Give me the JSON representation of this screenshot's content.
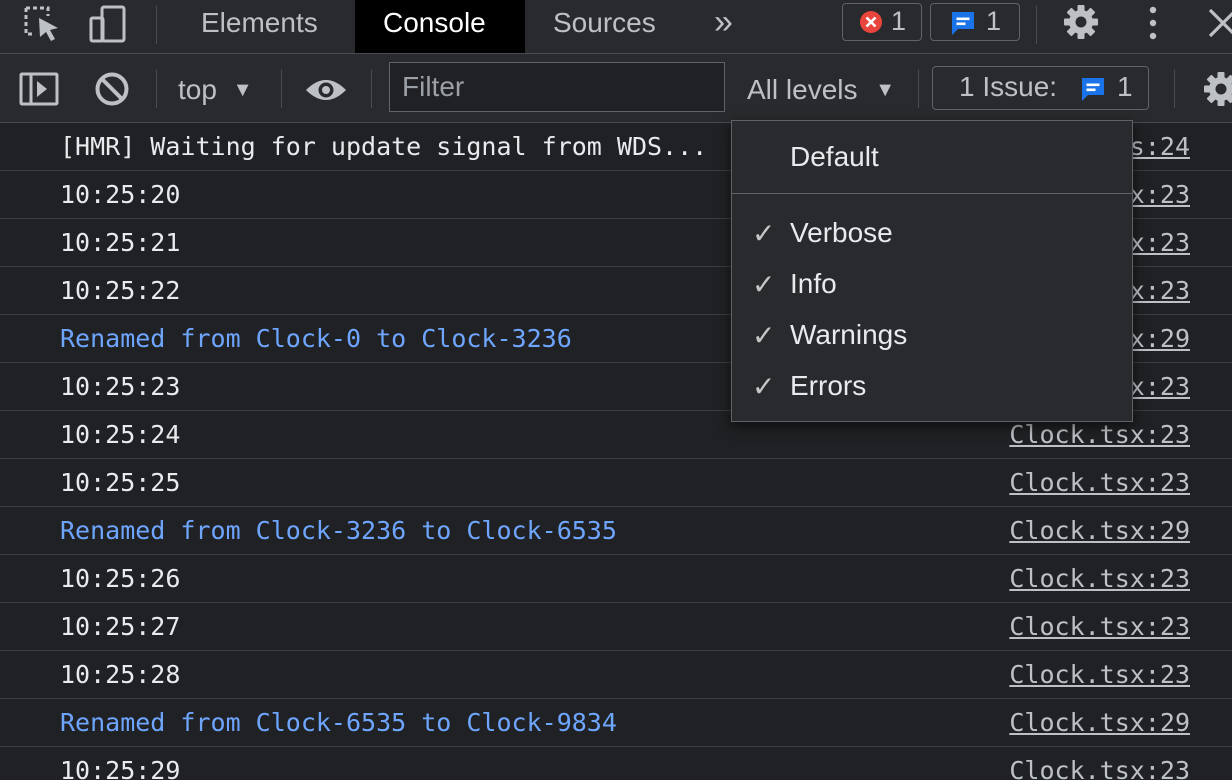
{
  "tabs": {
    "items": [
      {
        "label": "Elements"
      },
      {
        "label": "Console"
      },
      {
        "label": "Sources"
      }
    ],
    "more": "»",
    "errors_count": "1",
    "messages_count": "1"
  },
  "toolbar": {
    "context": "top",
    "filter_placeholder": "Filter",
    "levels_label": "All levels",
    "issues_label": "1 Issue:",
    "issues_count": "1"
  },
  "levels_menu": {
    "default_label": "Default",
    "items": [
      {
        "label": "Verbose",
        "checked": true
      },
      {
        "label": "Info",
        "checked": true
      },
      {
        "label": "Warnings",
        "checked": true
      },
      {
        "label": "Errors",
        "checked": true
      }
    ]
  },
  "console": {
    "rows": [
      {
        "message": "[HMR] Waiting for update signal from WDS...",
        "source": "log.js:24",
        "type": "log"
      },
      {
        "message": "10:25:20",
        "source": "Clock.tsx:23",
        "type": "log"
      },
      {
        "message": "10:25:21",
        "source": "Clock.tsx:23",
        "type": "log"
      },
      {
        "message": "10:25:22",
        "source": "Clock.tsx:23",
        "type": "log"
      },
      {
        "message": "Renamed from Clock-0 to Clock-3236",
        "source": "Clock.tsx:29",
        "type": "info"
      },
      {
        "message": "10:25:23",
        "source": "Clock.tsx:23",
        "type": "log"
      },
      {
        "message": "10:25:24",
        "source": "Clock.tsx:23",
        "type": "log"
      },
      {
        "message": "10:25:25",
        "source": "Clock.tsx:23",
        "type": "log"
      },
      {
        "message": "Renamed from Clock-3236 to Clock-6535",
        "source": "Clock.tsx:29",
        "type": "info"
      },
      {
        "message": "10:25:26",
        "source": "Clock.tsx:23",
        "type": "log"
      },
      {
        "message": "10:25:27",
        "source": "Clock.tsx:23",
        "type": "log"
      },
      {
        "message": "10:25:28",
        "source": "Clock.tsx:23",
        "type": "log"
      },
      {
        "message": "Renamed from Clock-6535 to Clock-9834",
        "source": "Clock.tsx:29",
        "type": "info"
      },
      {
        "message": "10:25:29",
        "source": "Clock.tsx:23",
        "type": "log"
      }
    ]
  },
  "colors": {
    "background": "#202124",
    "toolbar": "#292a2d",
    "info_text": "#6ea6ff",
    "error_badge": "#e8453c",
    "message_badge": "#1a73e8"
  },
  "icons": {
    "inspect": "inspect-element-icon",
    "device": "device-toolbar-icon",
    "error": "error-icon",
    "message": "message-icon",
    "settings": "gear-icon",
    "menu": "kebab-menu-icon",
    "close": "close-icon",
    "sidebar": "sidebar-toggle-icon",
    "clear": "clear-console-icon",
    "live_expression": "eye-icon",
    "issues": "issue-message-icon"
  }
}
